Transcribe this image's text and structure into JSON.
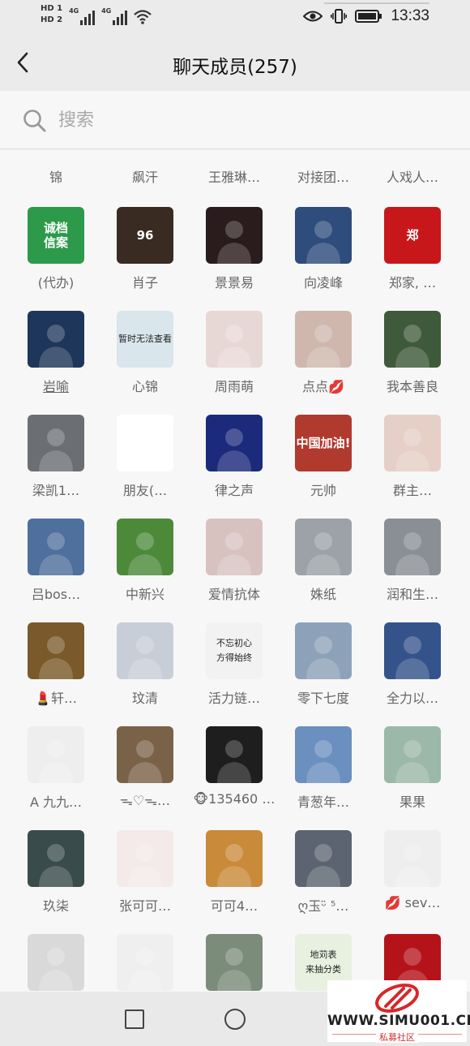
{
  "status_bar": {
    "hd1": "HD 1",
    "hd2": "HD 2",
    "sig1": "4G",
    "sig2": "4G",
    "time": "13:33"
  },
  "header": {
    "title": "聊天成员(257)",
    "back_icon": "back-arrow-icon"
  },
  "search": {
    "placeholder": "搜索",
    "icon": "search-icon"
  },
  "top_row_names": [
    "锦",
    "飙汗",
    "王雅琳…",
    "对接团…",
    "人戏人…"
  ],
  "members": [
    {
      "name": "(代办)",
      "avatar": {
        "bg": "#2d9a4b",
        "text": "诚档\n信案"
      }
    },
    {
      "name": "肖子",
      "avatar": {
        "bg": "#3a2b22",
        "text": "96"
      }
    },
    {
      "name": "景景易",
      "avatar": {
        "bg": "#2a1c1c"
      }
    },
    {
      "name": "向凌峰",
      "avatar": {
        "bg": "#2e4c7c"
      }
    },
    {
      "name": "郑家, …",
      "avatar": {
        "bg": "#c8171b",
        "text": "郑"
      }
    },
    {
      "name": "岩喻",
      "avatar": {
        "bg": "#1e3659"
      }
    },
    {
      "name": "心锦",
      "avatar": {
        "bg": "#d9e6ec",
        "text": "暂时无法查看"
      }
    },
    {
      "name": "周雨萌",
      "avatar": {
        "bg": "#e8d8d5"
      }
    },
    {
      "name": "点点💋",
      "avatar": {
        "bg": "#cfb7ad"
      }
    },
    {
      "name": "我本善良",
      "avatar": {
        "bg": "#3f5a3a"
      }
    },
    {
      "name": "梁凯1…",
      "avatar": {
        "bg": "#6b6f74"
      }
    },
    {
      "name": "朋友(…",
      "avatar": {
        "bg": "#ffffff"
      }
    },
    {
      "name": "律之声",
      "avatar": {
        "bg": "#1b2a7a"
      }
    },
    {
      "name": "元帅",
      "avatar": {
        "bg": "#b03a2e",
        "text": "中国加油!"
      }
    },
    {
      "name": "群主…",
      "avatar": {
        "bg": "#e5cfc6"
      }
    },
    {
      "name": "吕bos…",
      "avatar": {
        "bg": "#4f6f9c"
      }
    },
    {
      "name": "中新兴",
      "avatar": {
        "bg": "#4c8a3a"
      }
    },
    {
      "name": "爱情抗体",
      "avatar": {
        "bg": "#d8c2c0"
      }
    },
    {
      "name": "姝纸",
      "avatar": {
        "bg": "#9ca2a8"
      }
    },
    {
      "name": "润和生…",
      "avatar": {
        "bg": "#8a8f95"
      }
    },
    {
      "name": "💄轩…",
      "avatar": {
        "bg": "#7a5a2a"
      }
    },
    {
      "name": "玟清",
      "avatar": {
        "bg": "#c7ced8"
      }
    },
    {
      "name": "活力链…",
      "avatar": {
        "bg": "#f2f2f2",
        "text": "不忘初心\n方得始终"
      }
    },
    {
      "name": "零下七度",
      "avatar": {
        "bg": "#8da2b8"
      }
    },
    {
      "name": "全力以…",
      "avatar": {
        "bg": "#34538a"
      }
    },
    {
      "name": "A 九九…",
      "avatar": {
        "bg": "#eeeeee"
      }
    },
    {
      "name": "ᯓ♡ᯓ…",
      "avatar": {
        "bg": "#7a6248"
      }
    },
    {
      "name": "🐵135460 …",
      "avatar": {
        "bg": "#1e1e1e"
      }
    },
    {
      "name": "青葱年…",
      "avatar": {
        "bg": "#6b8fbf"
      }
    },
    {
      "name": "果果",
      "avatar": {
        "bg": "#9bb8a8"
      }
    },
    {
      "name": "玖柒",
      "avatar": {
        "bg": "#3a4b4b"
      }
    },
    {
      "name": "张可可…",
      "avatar": {
        "bg": "#f4eaea"
      }
    },
    {
      "name": "可可4…",
      "avatar": {
        "bg": "#c98a3a"
      }
    },
    {
      "name": "ღ玉ᵕ̈ ⁵…",
      "avatar": {
        "bg": "#5b6470"
      }
    },
    {
      "name": "💋 sev…",
      "avatar": {
        "bg": "#eeeeee"
      }
    },
    {
      "name": "",
      "avatar": {
        "bg": "#d9d9d9"
      }
    },
    {
      "name": "",
      "avatar": {
        "bg": "#efefef"
      }
    },
    {
      "name": "",
      "avatar": {
        "bg": "#7b8c7a"
      }
    },
    {
      "name": "",
      "avatar": {
        "bg": "#e8f0e0",
        "text": "地苅表\n来抽分类"
      }
    },
    {
      "name": "",
      "avatar": {
        "bg": "#b5131a"
      }
    }
  ],
  "watermark": {
    "site": "WWW.SIMU001.CN",
    "cn": "私募社区"
  },
  "colors": {
    "bar_bg": "#ebebeb",
    "page_bg": "#f7f7f7",
    "watermark_red": "#d9262a"
  }
}
